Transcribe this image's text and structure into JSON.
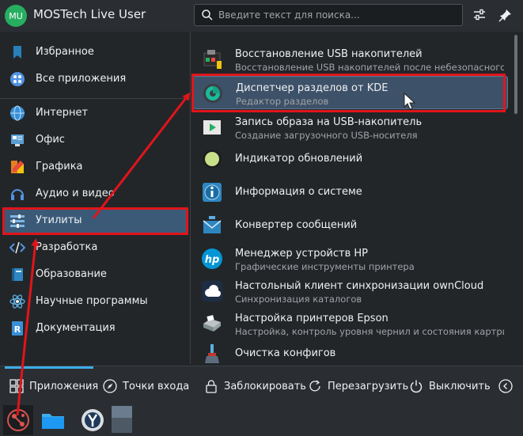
{
  "header": {
    "avatar_initials": "MU",
    "user_name": "MOSTech Live User",
    "search_placeholder": "Введите текст для поиска..."
  },
  "sidebar": {
    "items": [
      {
        "label": "Избранное",
        "icon": "bookmark-icon"
      },
      {
        "label": "Все приложения",
        "icon": "grid-icon"
      },
      {
        "label": "Интернет",
        "icon": "globe-icon"
      },
      {
        "label": "Офис",
        "icon": "office-icon"
      },
      {
        "label": "Графика",
        "icon": "graphics-icon"
      },
      {
        "label": "Аудио и видео",
        "icon": "headphones-icon"
      },
      {
        "label": "Утилиты",
        "icon": "utilities-icon"
      },
      {
        "label": "Разработка",
        "icon": "code-icon"
      },
      {
        "label": "Образование",
        "icon": "education-icon"
      },
      {
        "label": "Научные программы",
        "icon": "atom-icon"
      },
      {
        "label": "Документация",
        "icon": "documentation-icon"
      }
    ],
    "active_index": 6
  },
  "apps": [
    {
      "name": "Восстановление USB накопителей",
      "desc": "Восстановление USB накопителей после небезопасного ..."
    },
    {
      "name": "Диспетчер разделов от KDE",
      "desc": "Редактор разделов"
    },
    {
      "name": "Запись образа на USB-накопитель",
      "desc": "Создание загрузочного USB-носителя"
    },
    {
      "name": "Индикатор обновлений",
      "desc": ""
    },
    {
      "name": "Информация о системе",
      "desc": ""
    },
    {
      "name": "Конвертер сообщений",
      "desc": ""
    },
    {
      "name": "Менеджер устройств HP",
      "desc": "Графические инструменты принтера"
    },
    {
      "name": "Настольный клиент синхронизации ownCloud",
      "desc": "Синхронизация каталогов"
    },
    {
      "name": "Настройка принтеров Epson",
      "desc": "Настройка, контроль уровня чернил и состояния картри..."
    },
    {
      "name": "Очистка конфигов",
      "desc": ""
    }
  ],
  "footer": {
    "applications": "Приложения",
    "places": "Точки входа",
    "lock": "Заблокировать",
    "restart": "Перезагрузить",
    "shutdown": "Выключить"
  },
  "colors": {
    "accent": "#3daee9",
    "annotation": "#e0151b",
    "highlight": "#3d5168"
  }
}
